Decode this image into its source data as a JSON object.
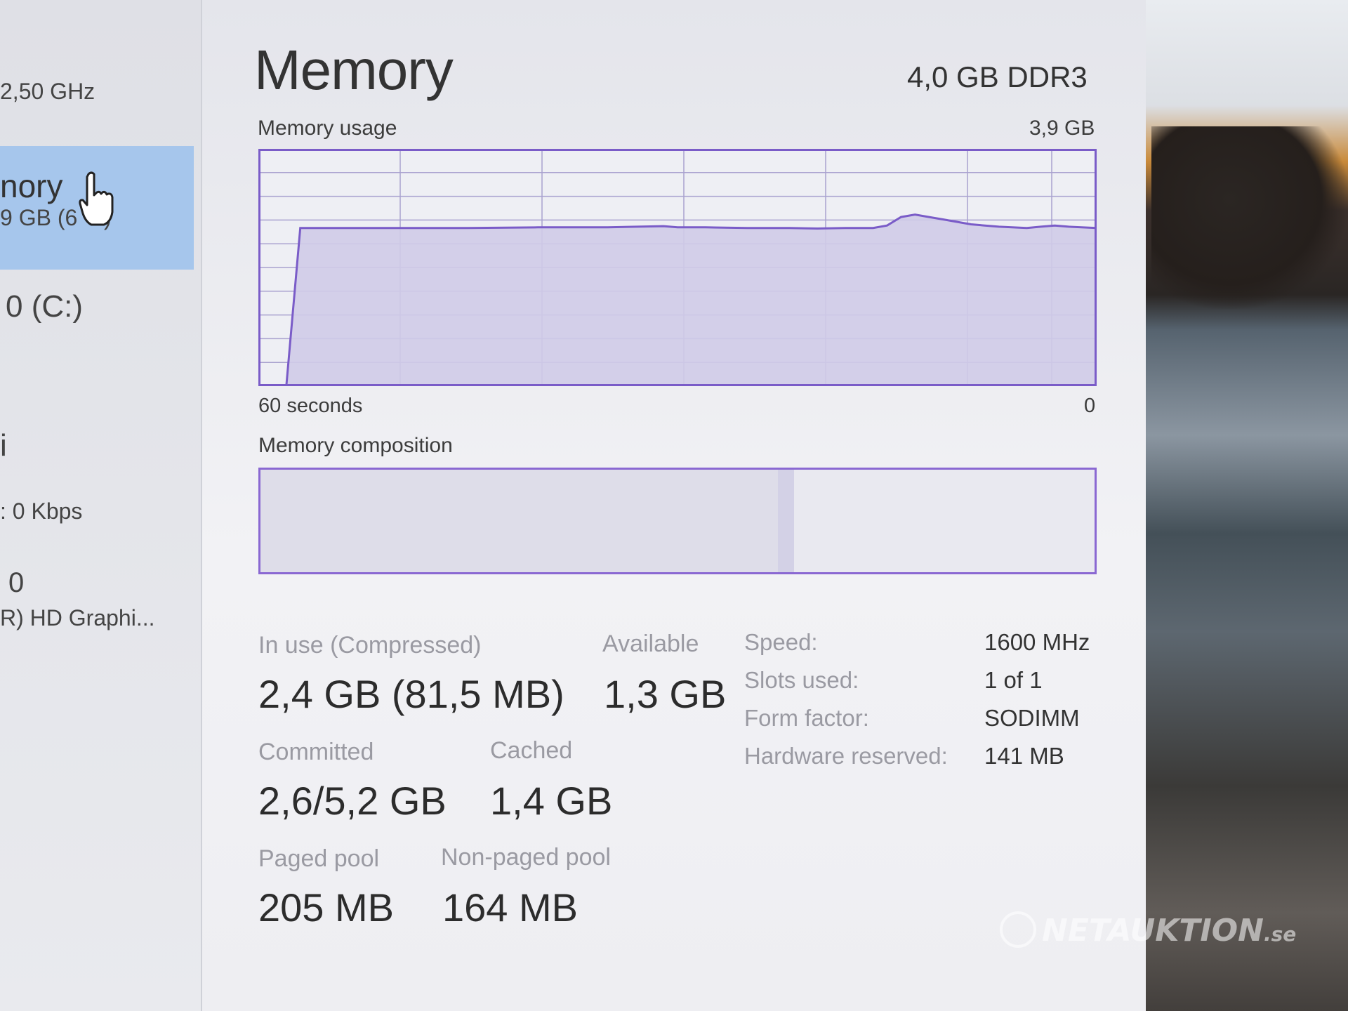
{
  "sidebar": {
    "cpu_speed": "2,50 GHz",
    "memory_name": "nory",
    "memory_detail": "9 GB (6",
    "memory_detail_end": ")",
    "disk": "0 (C:)",
    "wifi": "i",
    "wifi_rate": ": 0 Kbps",
    "gpu_index": "0",
    "gpu_name": "R) HD Graphi..."
  },
  "header": {
    "title": "Memory",
    "subtitle": "4,0 GB DDR3"
  },
  "usage_graph": {
    "label": "Memory usage",
    "max_label": "3,9 GB",
    "time_left": "60 seconds",
    "time_right": "0",
    "line_color": "#7a5cc8",
    "fill_color": "#cfcbe8",
    "grid_color": "#a9a2cf"
  },
  "chart_data": {
    "type": "area",
    "title": "Memory usage",
    "xlabel": "",
    "ylabel": "",
    "x": [
      60,
      58,
      57,
      56,
      54,
      50,
      45,
      40,
      35,
      31,
      30,
      28,
      25,
      22,
      20,
      18,
      16,
      15,
      14,
      13,
      12,
      11,
      10,
      9,
      8,
      7,
      5,
      4,
      3,
      2,
      0
    ],
    "y": [
      0,
      0,
      2.6,
      2.6,
      2.6,
      2.6,
      2.6,
      2.61,
      2.61,
      2.63,
      2.61,
      2.61,
      2.6,
      2.6,
      2.59,
      2.6,
      2.6,
      2.64,
      2.78,
      2.82,
      2.78,
      2.74,
      2.7,
      2.66,
      2.64,
      2.62,
      2.6,
      2.62,
      2.64,
      2.62,
      2.6
    ],
    "xlim": [
      60,
      0
    ],
    "ylim": [
      0,
      3.9
    ],
    "grid": true
  },
  "composition": {
    "label": "Memory composition",
    "in_use_fraction": 0.62,
    "modified_fraction": 0.02
  },
  "stats": {
    "in_use_label": "In use (Compressed)",
    "in_use_value": "2,4 GB (81,5 MB)",
    "available_label": "Available",
    "available_value": "1,3 GB",
    "committed_label": "Committed",
    "committed_value": "2,6/5,2 GB",
    "cached_label": "Cached",
    "cached_value": "1,4 GB",
    "paged_label": "Paged pool",
    "paged_value": "205 MB",
    "nonpaged_label": "Non-paged pool",
    "nonpaged_value": "164 MB"
  },
  "specs": {
    "speed_label": "Speed:",
    "speed_value": "1600 MHz",
    "slots_label": "Slots used:",
    "slots_value": "1 of 1",
    "form_label": "Form factor:",
    "form_value": "SODIMM",
    "reserved_label": "Hardware reserved:",
    "reserved_value": "141 MB"
  },
  "watermark": {
    "text": "NETAUKTION",
    "suffix": ".se"
  },
  "icons": {
    "cursor": "hand-pointer-icon",
    "logo": "hammer-logo-icon"
  }
}
